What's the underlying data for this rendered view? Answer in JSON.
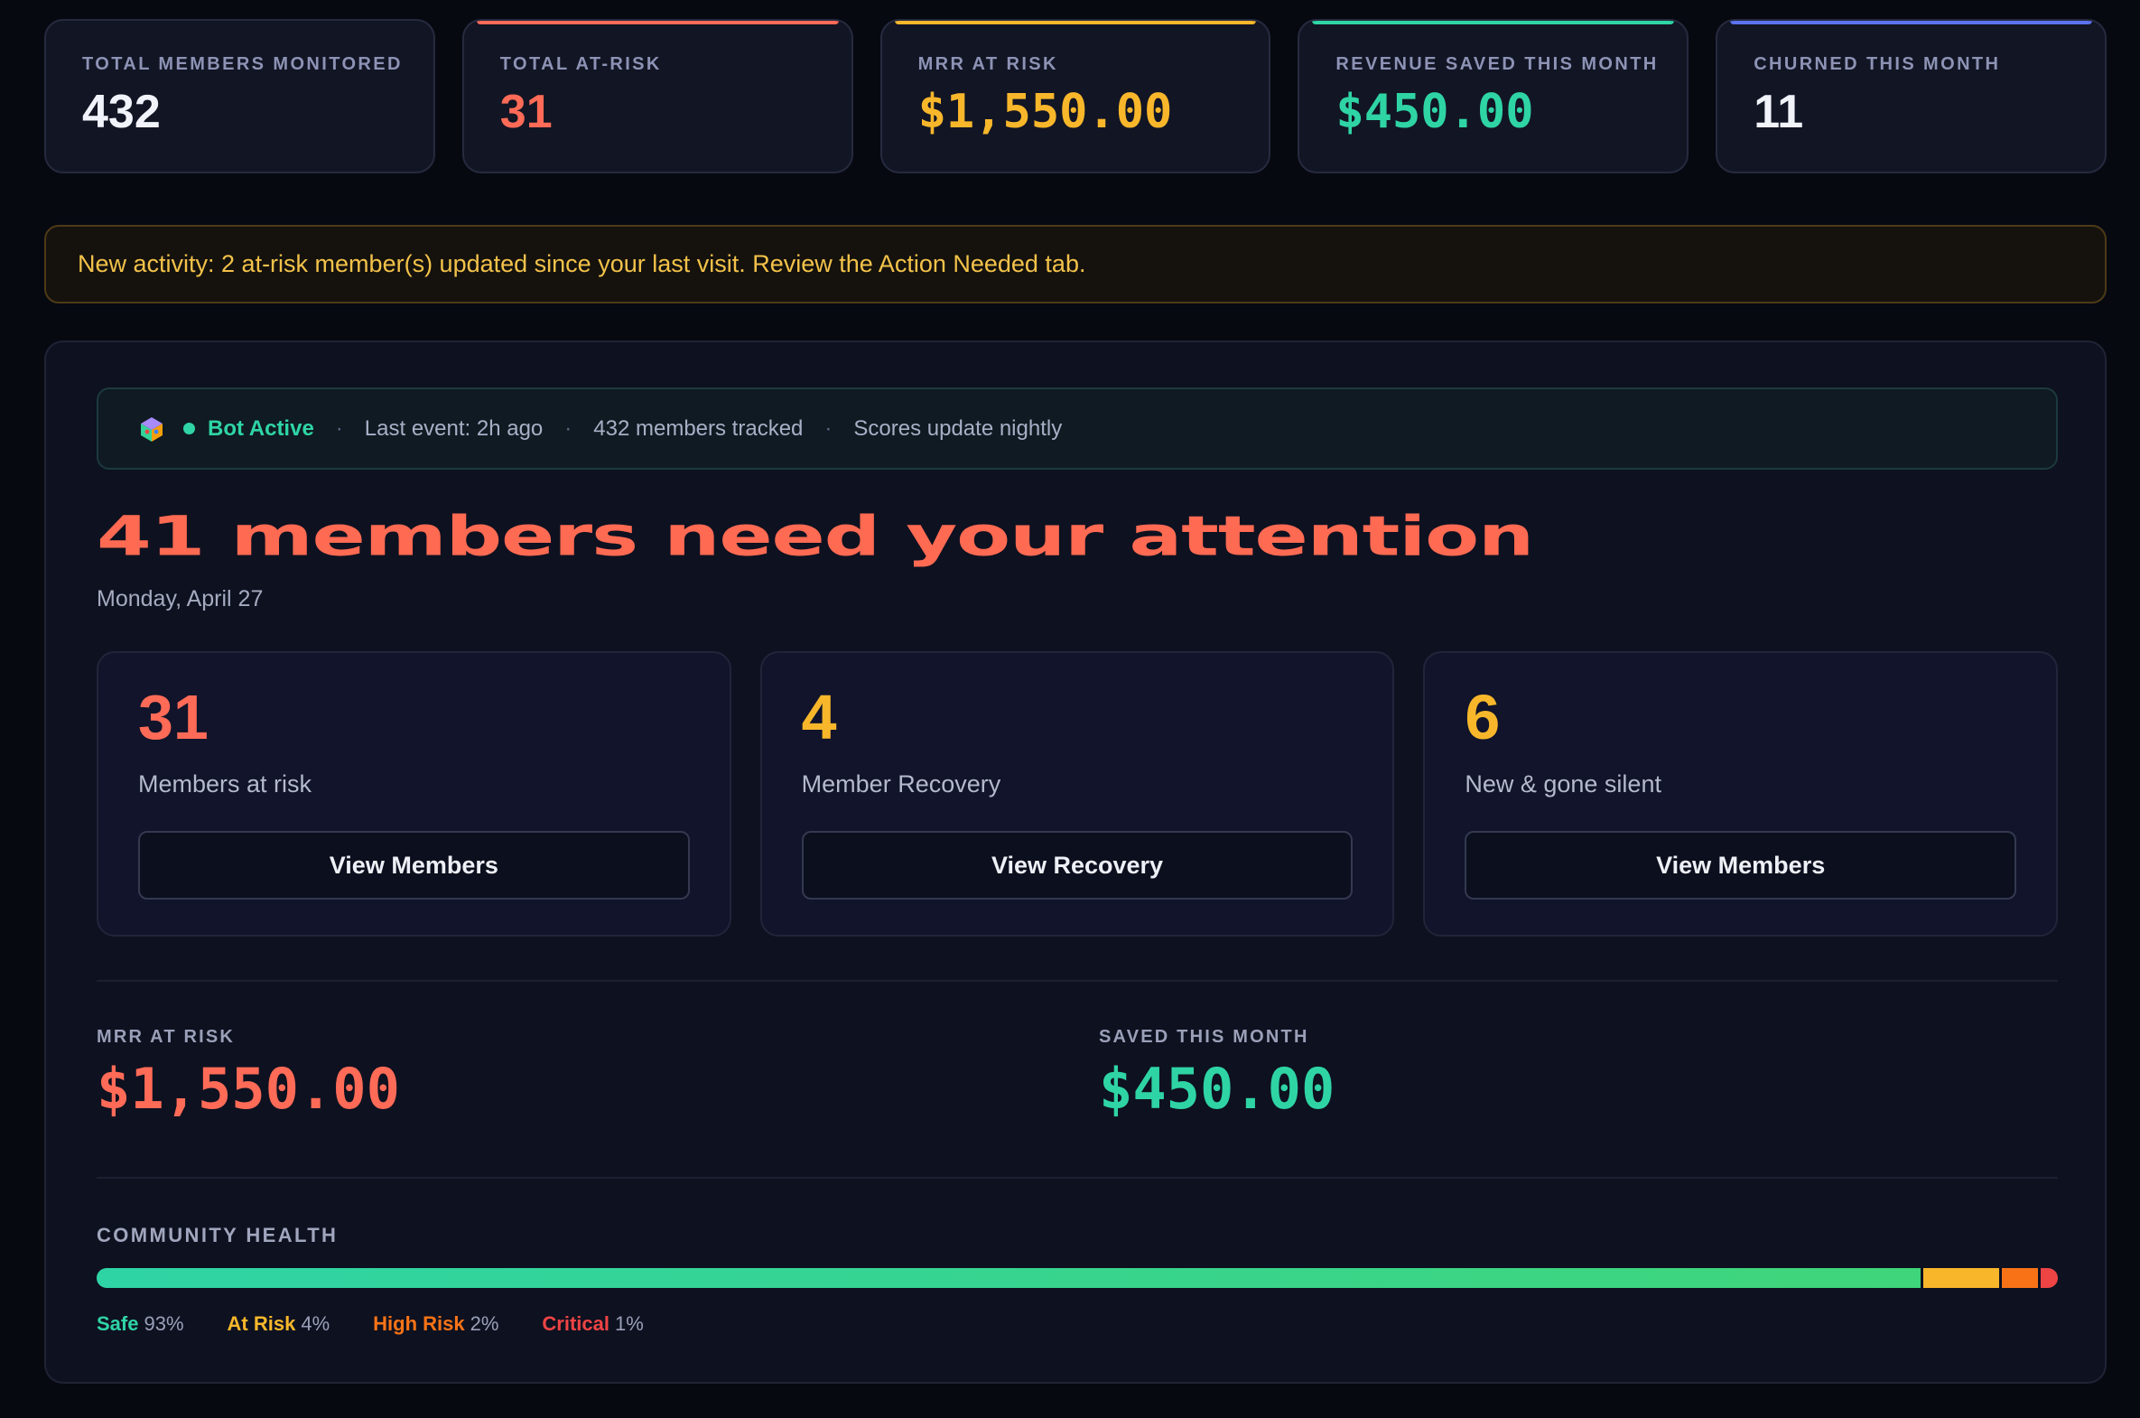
{
  "stats": [
    {
      "label": "TOTAL MEMBERS MONITORED",
      "value": "432",
      "color": "#f1f3fa",
      "accent": ""
    },
    {
      "label": "TOTAL AT-RISK",
      "value": "31",
      "color": "#ff6b57",
      "accent": "#ff6b57"
    },
    {
      "label": "MRR AT RISK",
      "value": "$1,550.00",
      "color": "#f8b72b",
      "accent": "#f8b72b"
    },
    {
      "label": "REVENUE SAVED THIS MONTH",
      "value": "$450.00",
      "color": "#2fd4a5",
      "accent": "#2fd4a5"
    },
    {
      "label": "CHURNED THIS MONTH",
      "value": "11",
      "color": "#f1f3fa",
      "accent": "#5b73f0"
    }
  ],
  "notice": "New activity: 2 at-risk member(s) updated since your last visit. Review the Action Needed tab.",
  "bot": {
    "status": "Bot Active",
    "last_event": "Last event: 2h ago",
    "tracked": "432 members tracked",
    "schedule": "Scores update nightly",
    "separator": "·",
    "icon": "bot-cube-icon"
  },
  "headline": "41 members need your attention",
  "date": "Monday, April 27",
  "cards": [
    {
      "number": "31",
      "label": "Members at risk",
      "button": "View Members",
      "color": "#ff6b57"
    },
    {
      "number": "4",
      "label": "Member Recovery",
      "button": "View Recovery",
      "color": "#f8b72b"
    },
    {
      "number": "6",
      "label": "New & gone silent",
      "button": "View Members",
      "color": "#f8b72b"
    }
  ],
  "mrr": {
    "label": "MRR AT RISK",
    "value": "$1,550.00",
    "color": "#ff6b57"
  },
  "saved": {
    "label": "SAVED THIS MONTH",
    "value": "$450.00",
    "color": "#2fd4a5"
  },
  "health": {
    "label": "COMMUNITY HEALTH",
    "segments": [
      {
        "name": "Safe",
        "pct": 93,
        "pct_label": "93%",
        "color": "#2fd4a5"
      },
      {
        "name": "At Risk",
        "pct": 4,
        "pct_label": "4%",
        "color": "#f8b72b"
      },
      {
        "name": "High Risk",
        "pct": 2,
        "pct_label": "2%",
        "color": "#f97316"
      },
      {
        "name": "Critical",
        "pct": 1,
        "pct_label": "1%",
        "color": "#ef4444"
      }
    ]
  }
}
